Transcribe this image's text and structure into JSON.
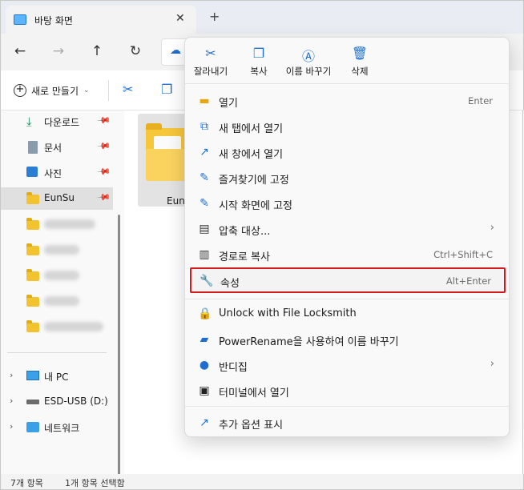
{
  "window": {
    "tab_title": "바탕 화면",
    "close_tab": "✕",
    "new_tab": "+"
  },
  "nav": {
    "back": "←",
    "forward": "→",
    "up": "↑",
    "refresh": "↻"
  },
  "commandbar": {
    "new_label": "새로 만들기",
    "new_chevron": "⌄"
  },
  "sidebar": {
    "quick_access": [
      {
        "label": "다운로드",
        "icon": "download-icon"
      },
      {
        "label": "문서",
        "icon": "document-icon"
      },
      {
        "label": "사진",
        "icon": "pictures-icon"
      },
      {
        "label": "EunSu",
        "icon": "folder-icon"
      }
    ],
    "tree": [
      {
        "label": "내 PC",
        "icon": "pc-icon"
      },
      {
        "label": "ESD-USB (D:)",
        "icon": "drive-icon"
      },
      {
        "label": "네트워크",
        "icon": "network-icon"
      }
    ]
  },
  "content": {
    "file_label": "Eun"
  },
  "status": {
    "count": "7개 항목",
    "selected": "1개 항목 선택함"
  },
  "context_menu": {
    "quick_actions": [
      {
        "label": "잘라내기",
        "icon": "cut-icon",
        "glyph": "✂"
      },
      {
        "label": "복사",
        "icon": "copy-icon",
        "glyph": "❐"
      },
      {
        "label": "이름 바꾸기",
        "icon": "rename-icon",
        "glyph": "Ⓐ"
      },
      {
        "label": "삭제",
        "icon": "trash-icon",
        "glyph": "🗑"
      }
    ],
    "items": [
      {
        "label": "열기",
        "shortcut": "Enter",
        "icon": "open-folder-icon"
      },
      {
        "label": "새 탭에서 열기",
        "shortcut": "",
        "icon": "new-tab-icon"
      },
      {
        "label": "새 창에서 열기",
        "shortcut": "",
        "icon": "new-window-icon"
      },
      {
        "label": "즐겨찾기에 고정",
        "shortcut": "",
        "icon": "pin-icon"
      },
      {
        "label": "시작 화면에 고정",
        "shortcut": "",
        "icon": "pin-start-icon"
      },
      {
        "label": "압축 대상...",
        "shortcut": "",
        "icon": "compress-icon"
      },
      {
        "label": "경로로 복사",
        "shortcut": "Ctrl+Shift+C",
        "icon": "copy-path-icon"
      },
      {
        "label": "속성",
        "shortcut": "Alt+Enter",
        "icon": "wrench-icon"
      }
    ],
    "extra_items": [
      {
        "label": "Unlock with File Locksmith",
        "icon": "lock-icon"
      },
      {
        "label": "PowerRename을 사용하여 이름 바꾸기",
        "icon": "powerrename-icon"
      },
      {
        "label": "반디집",
        "icon": "bandizip-icon"
      },
      {
        "label": "터미널에서 열기",
        "icon": "terminal-icon"
      }
    ],
    "more_options": "추가 옵션 표시",
    "submenu_arrow": "›"
  }
}
